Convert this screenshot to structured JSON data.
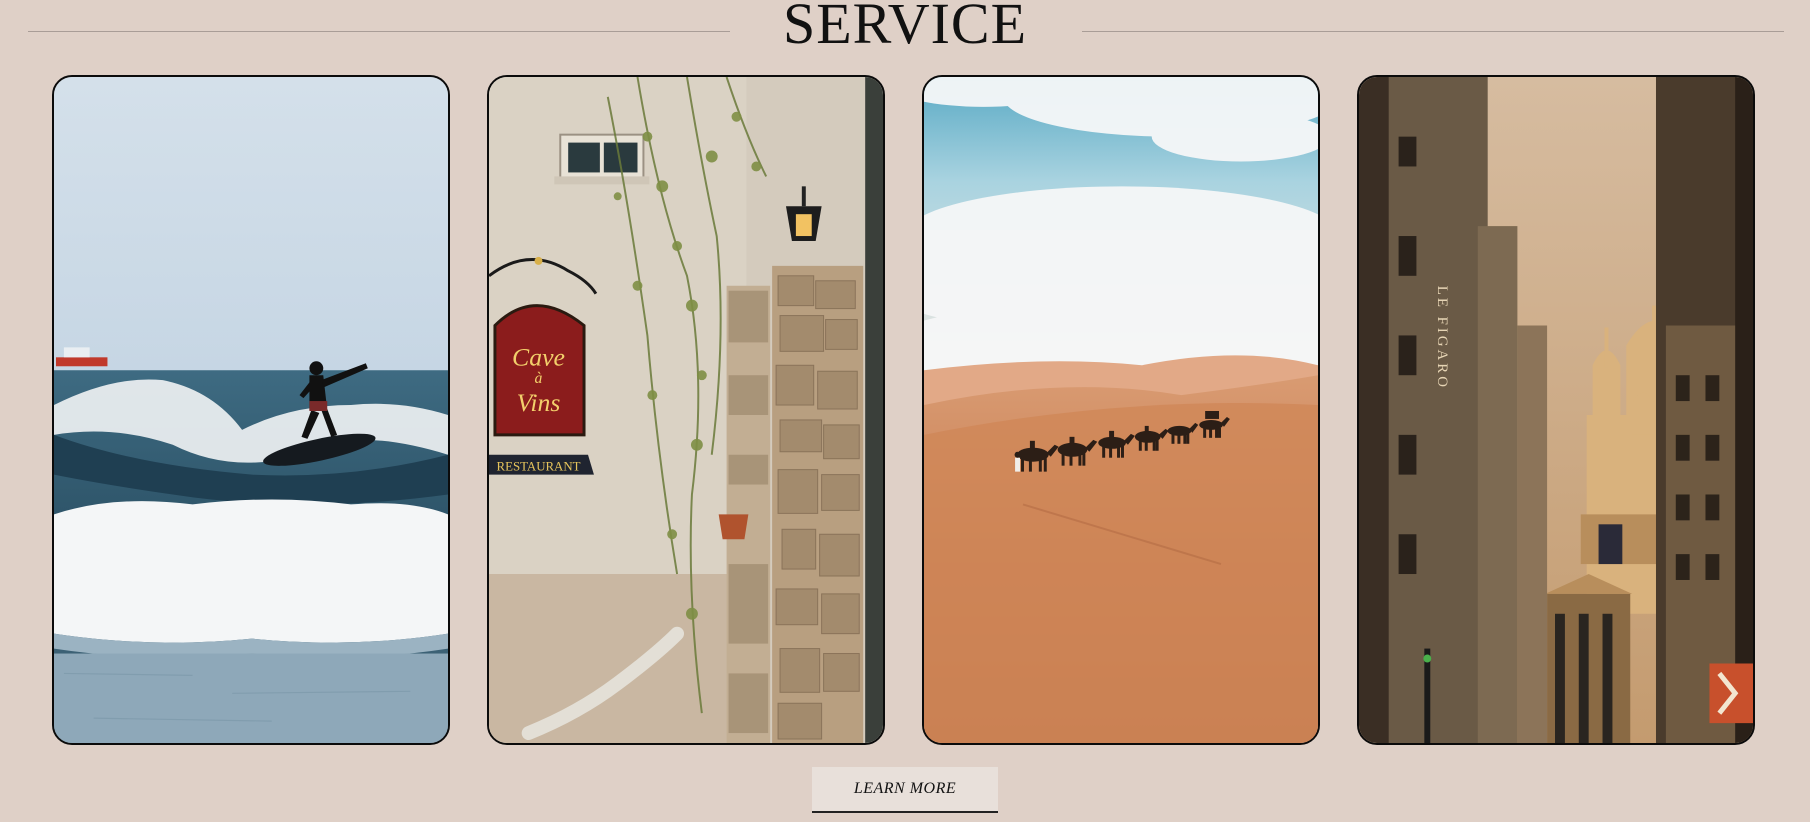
{
  "section": {
    "title": "SERVICE"
  },
  "cards": [
    {
      "subject": "surfer-on-wave"
    },
    {
      "subject": "cave-a-vins-restaurant-wall",
      "sign_text": [
        "Cave",
        "à",
        "Vins"
      ],
      "banner_text": "RESTAURANT"
    },
    {
      "subject": "camel-caravan-in-desert"
    },
    {
      "subject": "paris-street-sacre-coeur",
      "facade_text": "LE FIGARO"
    }
  ],
  "cta": {
    "label": "LEARN MORE"
  }
}
